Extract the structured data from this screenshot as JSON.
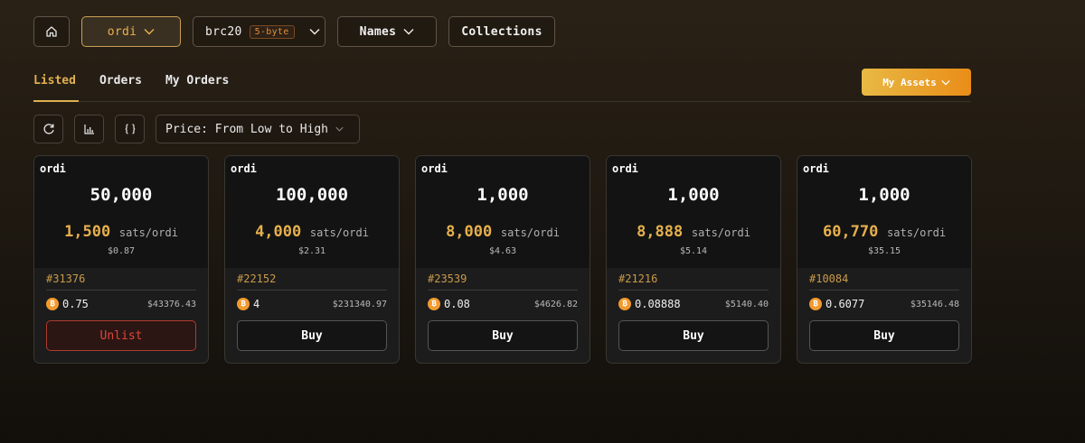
{
  "topbar": {
    "home_icon": "home-icon",
    "ticker_label": "ordi",
    "protocol_label": "brc20",
    "protocol_badge": "5-byte",
    "names_label": "Names",
    "collections_label": "Collections"
  },
  "tabs": [
    {
      "label": "Listed",
      "active": true
    },
    {
      "label": "Orders",
      "active": false
    },
    {
      "label": "My Orders",
      "active": false
    }
  ],
  "my_assets_label": "My Assets",
  "toolbar": {
    "refresh_icon": "refresh-icon",
    "chart_icon": "bar-chart-icon",
    "code_icon": "braces-icon",
    "sort_label": "Price: From Low to High"
  },
  "colors": {
    "accent": "#e0b050",
    "price": "#e6b04d",
    "unlist": "#e0463a",
    "btc": "#f29a2e"
  },
  "cards": [
    {
      "ticker": "ordi",
      "amount": "50,000",
      "unit_price": "1,500",
      "unit": "sats/ordi",
      "unit_usd": "$0.87",
      "inscription": "#31376",
      "btc": "0.75",
      "total_usd": "$43376.43",
      "action": "Unlist"
    },
    {
      "ticker": "ordi",
      "amount": "100,000",
      "unit_price": "4,000",
      "unit": "sats/ordi",
      "unit_usd": "$2.31",
      "inscription": "#22152",
      "btc": "4",
      "total_usd": "$231340.97",
      "action": "Buy"
    },
    {
      "ticker": "ordi",
      "amount": "1,000",
      "unit_price": "8,000",
      "unit": "sats/ordi",
      "unit_usd": "$4.63",
      "inscription": "#23539",
      "btc": "0.08",
      "total_usd": "$4626.82",
      "action": "Buy"
    },
    {
      "ticker": "ordi",
      "amount": "1,000",
      "unit_price": "8,888",
      "unit": "sats/ordi",
      "unit_usd": "$5.14",
      "inscription": "#21216",
      "btc": "0.08888",
      "total_usd": "$5140.40",
      "action": "Buy"
    },
    {
      "ticker": "ordi",
      "amount": "1,000",
      "unit_price": "60,770",
      "unit": "sats/ordi",
      "unit_usd": "$35.15",
      "inscription": "#10084",
      "btc": "0.6077",
      "total_usd": "$35146.48",
      "action": "Buy"
    }
  ]
}
